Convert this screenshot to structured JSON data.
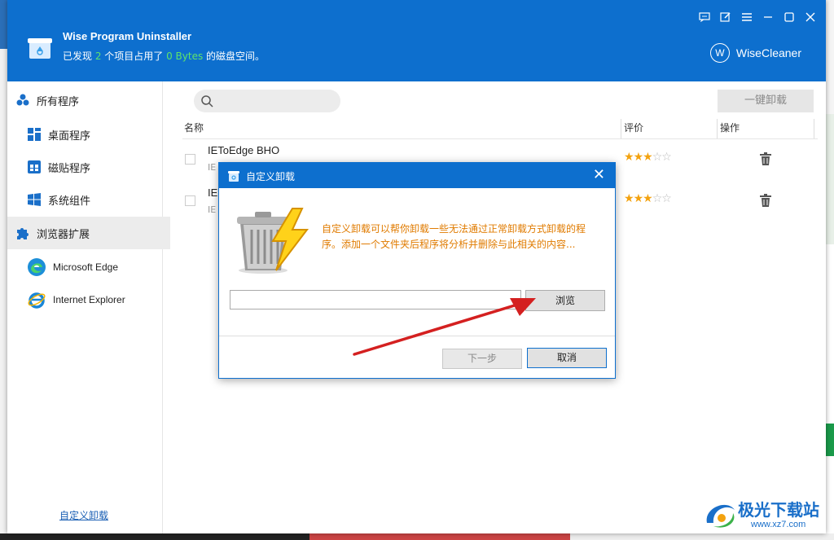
{
  "app": {
    "title": "Wise Program Uninstaller",
    "summary_prefix": "已发现 ",
    "summary_count": "2",
    "summary_mid": " 个项目占用了 ",
    "summary_size": "0 Bytes",
    "summary_suffix": " 的磁盘空间。",
    "brand": "WiseCleaner",
    "brand_letter": "W"
  },
  "window_controls": [
    "feedback-icon",
    "edit-icon",
    "menu-icon",
    "minimize-icon",
    "maximize-icon",
    "close-icon"
  ],
  "sidebar": {
    "items": [
      {
        "label": "所有程序",
        "icon": "all-programs-icon"
      },
      {
        "label": "桌面程序",
        "icon": "desktop-programs-icon"
      },
      {
        "label": "磁贴程序",
        "icon": "tile-programs-icon"
      },
      {
        "label": "系统组件",
        "icon": "windows-icon"
      },
      {
        "label": "浏览器扩展",
        "icon": "puzzle-icon"
      }
    ],
    "browsers": [
      {
        "label": "Microsoft Edge",
        "icon": "edge-icon"
      },
      {
        "label": "Internet Explorer",
        "icon": "ie-icon"
      }
    ],
    "custom_uninstall_link": "自定义卸载"
  },
  "toolbar": {
    "search_placeholder": "",
    "one_click_uninstall": "一键卸载"
  },
  "table": {
    "columns": [
      "名称",
      "评价",
      "操作"
    ],
    "rows": [
      {
        "name": "IEToEdge BHO",
        "sub": "IE",
        "rating": 3,
        "max_rating": 5
      },
      {
        "name": "IE",
        "sub": "IE",
        "rating": 3,
        "max_rating": 5
      }
    ]
  },
  "dialog": {
    "title": "自定义卸载",
    "description": "自定义卸载可以帮你卸载一些无法通过正常卸载方式卸载的程序。添加一个文件夹后程序将分析并删除与此相关的内容...",
    "path_value": "",
    "browse_label": "浏览",
    "next_label": "下一步",
    "cancel_label": "取消",
    "close_glyph": "✕"
  },
  "watermark": {
    "line1": "极光下载站",
    "line2": "www.xz7.com"
  },
  "colors": {
    "header_blue": "#0d6fce",
    "highlight_green": "#5fe36b",
    "description_orange": "#e07b00",
    "star_gold": "#f3a20f",
    "arrow_red": "#d42020"
  }
}
